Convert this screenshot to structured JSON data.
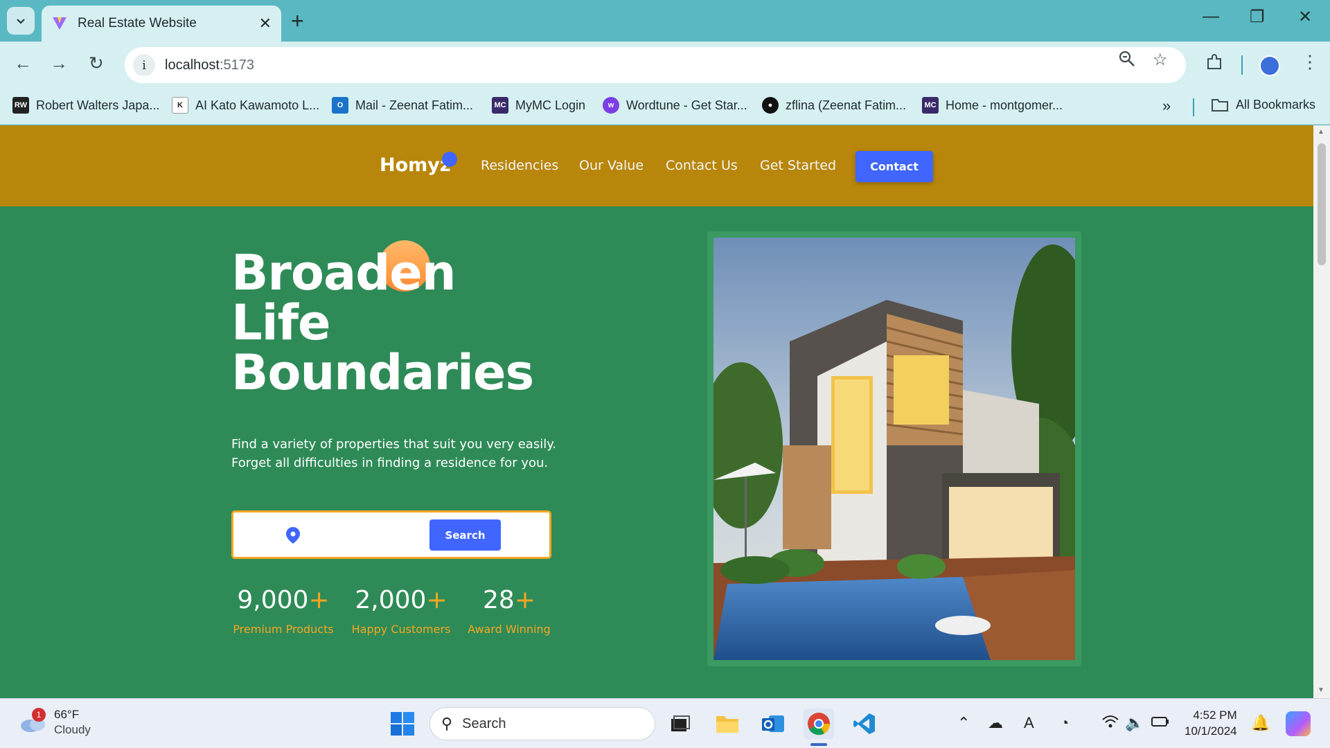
{
  "browser": {
    "tab_title": "Real Estate Website",
    "url_host": "localhost",
    "url_port": ":5173",
    "bookmarks": [
      {
        "label": "Robert Walters Japa...",
        "icon": "rw-icon",
        "color": "#222222"
      },
      {
        "label": "AI Kato Kawamoto L...",
        "icon": "kato-icon",
        "color": "#ffffff"
      },
      {
        "label": "Mail - Zeenat Fatim...",
        "icon": "outlook-icon",
        "color": "#1a73c9"
      },
      {
        "label": "MyMC Login",
        "icon": "mc-icon",
        "color": "#3a2a6a"
      },
      {
        "label": "Wordtune - Get Star...",
        "icon": "wordtune-icon",
        "color": "#7b3fe4"
      },
      {
        "label": "zflina (Zeenat Fatim...",
        "icon": "github-icon",
        "color": "#111111"
      },
      {
        "label": "Home - montgomer...",
        "icon": "mc-icon",
        "color": "#3a2a6a"
      }
    ],
    "all_bookmarks": "All Bookmarks"
  },
  "site": {
    "logo": "Homyz",
    "nav": [
      "Residencies",
      "Our Value",
      "Contact Us",
      "Get Started"
    ],
    "contact_button": "Contact",
    "hero_title": [
      "Broaden",
      "Life",
      "Boundaries"
    ],
    "hero_desc": [
      "Find a variety of properties that suit you very easily.",
      "Forget all difficulties in finding a residence for you."
    ],
    "search_button": "Search",
    "search_placeholder": "",
    "stats": [
      {
        "value": "9,000",
        "plus": "+",
        "label": "Premium Products"
      },
      {
        "value": "2,000",
        "plus": "+",
        "label": "Happy Customers"
      },
      {
        "value": "28",
        "plus": "+",
        "label": "Award Winning"
      }
    ],
    "colors": {
      "header": "#b8860b",
      "hero": "#2e8b57",
      "accent": "#4066ff",
      "orange": "#f5a623"
    }
  },
  "taskbar": {
    "temperature": "66°F",
    "condition": "Cloudy",
    "weather_badge": "1",
    "search_label": "Search",
    "time": "4:52 PM",
    "date": "10/1/2024"
  }
}
